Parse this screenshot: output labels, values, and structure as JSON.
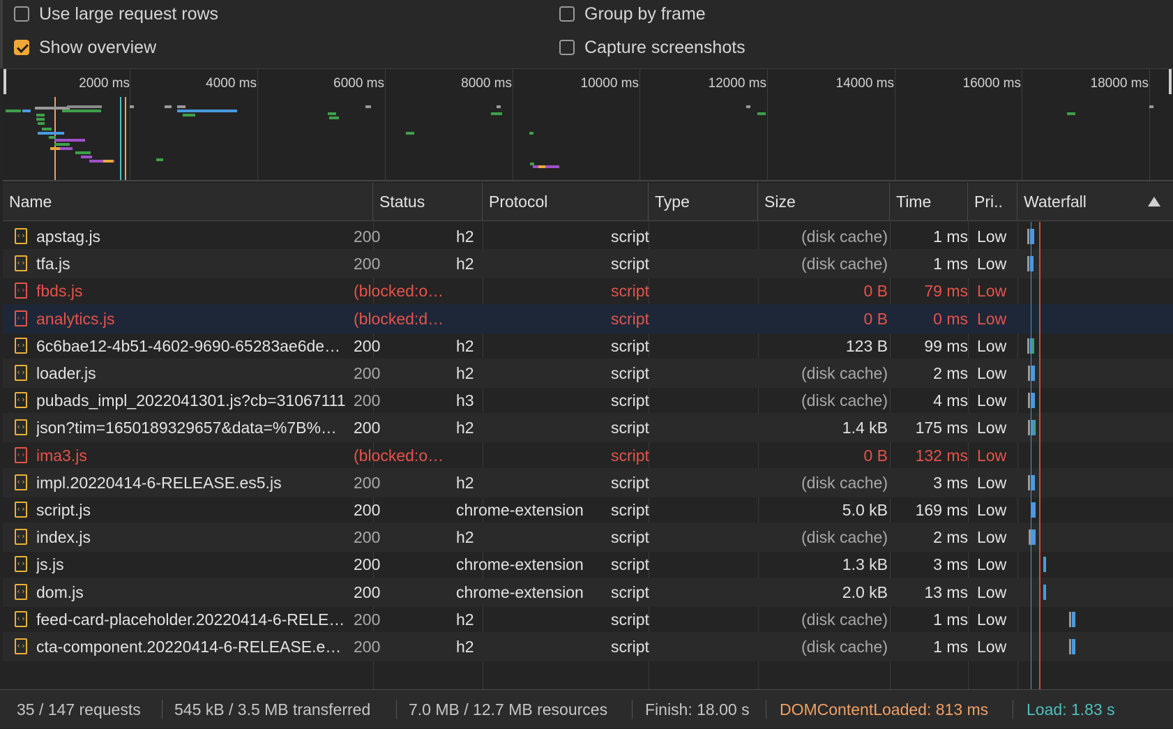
{
  "settings": {
    "large_rows_label": "Use large request rows",
    "group_by_frame_label": "Group by frame",
    "show_overview_label": "Show overview",
    "capture_screenshots_label": "Capture screenshots",
    "large_rows_checked": false,
    "group_by_frame_checked": false,
    "show_overview_checked": true,
    "capture_screenshots_checked": false
  },
  "overview": {
    "ticks": [
      "2000 ms",
      "4000 ms",
      "6000 ms",
      "8000 ms",
      "10000 ms",
      "12000 ms",
      "14000 ms",
      "16000 ms",
      "18000 ms"
    ]
  },
  "columns": {
    "name": "Name",
    "status": "Status",
    "protocol": "Protocol",
    "type": "Type",
    "size": "Size",
    "time": "Time",
    "priority": "Pri..",
    "waterfall": "Waterfall",
    "sort_icon": "sort-ascending-icon"
  },
  "rows": [
    {
      "name": "apstag.js",
      "status": "200",
      "protocol": "h2",
      "type": "script",
      "size": "(disk cache)",
      "time": "1 ms",
      "priority": "Low",
      "error": false,
      "status_dim": true,
      "size_dim": true
    },
    {
      "name": "tfa.js",
      "status": "200",
      "protocol": "h2",
      "type": "script",
      "size": "(disk cache)",
      "time": "1 ms",
      "priority": "Low",
      "error": false,
      "status_dim": true,
      "size_dim": true
    },
    {
      "name": "fbds.js",
      "status": "(blocked:o…",
      "protocol": "",
      "type": "script",
      "size": "0 B",
      "time": "79 ms",
      "priority": "Low",
      "error": true
    },
    {
      "name": "analytics.js",
      "status": "(blocked:d…",
      "protocol": "",
      "type": "script",
      "size": "0 B",
      "time": "0 ms",
      "priority": "Low",
      "error": true,
      "selected": true
    },
    {
      "name": "6c6bae12-4b51-4602-9690-65283ae6de…",
      "status": "200",
      "protocol": "h2",
      "type": "script",
      "size": "123 B",
      "time": "99 ms",
      "priority": "Low",
      "error": false
    },
    {
      "name": "loader.js",
      "status": "200",
      "protocol": "h2",
      "type": "script",
      "size": "(disk cache)",
      "time": "2 ms",
      "priority": "Low",
      "error": false,
      "status_dim": true,
      "size_dim": true
    },
    {
      "name": "pubads_impl_2022041301.js?cb=31067111",
      "status": "200",
      "protocol": "h3",
      "type": "script",
      "size": "(disk cache)",
      "time": "4 ms",
      "priority": "Low",
      "error": false,
      "status_dim": true,
      "size_dim": true
    },
    {
      "name": "json?tim=1650189329657&data=%7B%…",
      "status": "200",
      "protocol": "h2",
      "type": "script",
      "size": "1.4 kB",
      "time": "175 ms",
      "priority": "Low",
      "error": false
    },
    {
      "name": "ima3.js",
      "status": "(blocked:o…",
      "protocol": "",
      "type": "script",
      "size": "0 B",
      "time": "132 ms",
      "priority": "Low",
      "error": true
    },
    {
      "name": "impl.20220414-6-RELEASE.es5.js",
      "status": "200",
      "protocol": "h2",
      "type": "script",
      "size": "(disk cache)",
      "time": "3 ms",
      "priority": "Low",
      "error": false,
      "status_dim": true,
      "size_dim": true
    },
    {
      "name": "script.js",
      "status": "200",
      "protocol": "chrome-extension",
      "type": "script",
      "size": "5.0 kB",
      "time": "169 ms",
      "priority": "Low",
      "error": false
    },
    {
      "name": "index.js",
      "status": "200",
      "protocol": "h2",
      "type": "script",
      "size": "(disk cache)",
      "time": "2 ms",
      "priority": "Low",
      "error": false,
      "status_dim": true,
      "size_dim": true
    },
    {
      "name": "js.js",
      "status": "200",
      "protocol": "chrome-extension",
      "type": "script",
      "size": "1.3 kB",
      "time": "3 ms",
      "priority": "Low",
      "error": false
    },
    {
      "name": "dom.js",
      "status": "200",
      "protocol": "chrome-extension",
      "type": "script",
      "size": "2.0 kB",
      "time": "13 ms",
      "priority": "Low",
      "error": false
    },
    {
      "name": "feed-card-placeholder.20220414-6-RELE…",
      "status": "200",
      "protocol": "h2",
      "type": "script",
      "size": "(disk cache)",
      "time": "1 ms",
      "priority": "Low",
      "error": false,
      "status_dim": true,
      "size_dim": true
    },
    {
      "name": "cta-component.20220414-6-RELEASE.e…",
      "status": "200",
      "protocol": "h2",
      "type": "script",
      "size": "(disk cache)",
      "time": "1 ms",
      "priority": "Low",
      "error": false,
      "status_dim": true,
      "size_dim": true
    }
  ],
  "statusbar": {
    "requests": "35 / 147 requests",
    "transferred": "545 kB / 3.5 MB transferred",
    "resources": "7.0 MB / 12.7 MB resources",
    "finish": "Finish: 18.00 s",
    "dom_content_loaded": "DOMContentLoaded: 813 ms",
    "load": "Load: 1.83 s"
  },
  "colors": {
    "dcl": "#f0a064",
    "load": "#4ec0c0",
    "error": "#e5534b",
    "accent_checkbox": "#f0a73a",
    "bar_blue": "#4a9ae0",
    "bar_green": "#3ea04a"
  }
}
